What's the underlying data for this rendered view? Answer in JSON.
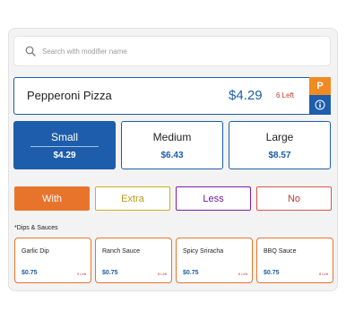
{
  "search": {
    "placeholder": "Search with modifier name",
    "icon": "search-icon"
  },
  "product": {
    "name": "Pepperoni Pizza",
    "price": "$4.29",
    "stock": "6 Left",
    "badge": "P"
  },
  "sizes": [
    {
      "label": "Small",
      "price": "$4.29",
      "selected": true
    },
    {
      "label": "Medium",
      "price": "$6.43",
      "selected": false
    },
    {
      "label": "Large",
      "price": "$8.57",
      "selected": false
    }
  ],
  "modifiers": [
    {
      "label": "With",
      "selected": true
    },
    {
      "label": "Extra",
      "selected": false
    },
    {
      "label": "Less",
      "selected": false
    },
    {
      "label": "No",
      "selected": false
    }
  ],
  "section_title": "*Dips & Sauces",
  "sauces": [
    {
      "name": "Garlic Dip",
      "price": "$0.75",
      "stock": "9 Left"
    },
    {
      "name": "Ranch Sauce",
      "price": "$0.75",
      "stock": "8 Left"
    },
    {
      "name": "Spicy Sriracha",
      "price": "$0.75",
      "stock": "6 Left"
    },
    {
      "name": "BBQ Sauce",
      "price": "$0.75",
      "stock": "8 Left"
    }
  ],
  "colors": {
    "primary": "#1d5dab",
    "accent": "#e8742c",
    "badge": "#f08a24",
    "extra": "#c8b125",
    "less": "#7b1fa2",
    "no": "#d9534f"
  }
}
